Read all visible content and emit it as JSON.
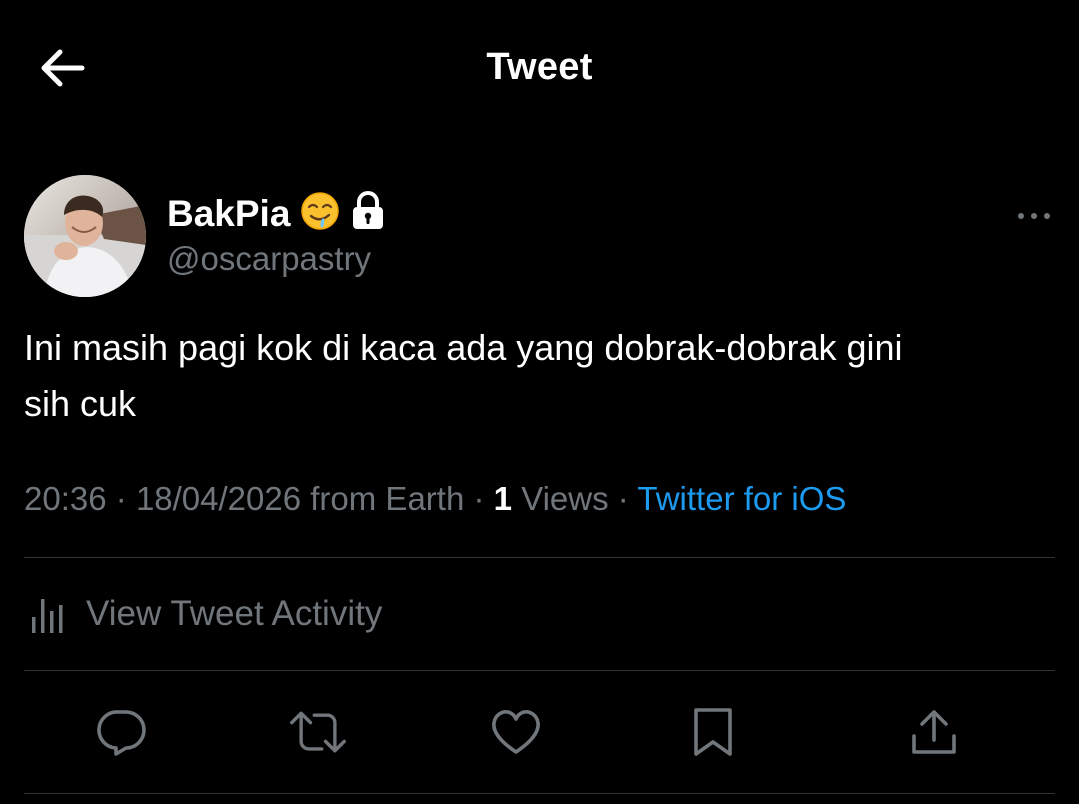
{
  "header": {
    "title": "Tweet",
    "back_icon": "arrow-left-icon"
  },
  "author": {
    "display_name": "BakPia",
    "emoji": "🤤",
    "protected_icon": "lock-icon",
    "handle": "@oscarpastry",
    "more_icon": "more-horizontal-icon"
  },
  "tweet": {
    "text_line1": "Ini masih pagi kok di kaca ada yang dobrak-dobrak gini",
    "text_line2": "sih cuk"
  },
  "meta": {
    "time": "20:36",
    "separator": "·",
    "date": "18/04/2026 from Earth",
    "views_count": "1",
    "views_label": "Views",
    "source": "Twitter for iOS"
  },
  "activity": {
    "icon": "analytics-icon",
    "label": "View Tweet Activity"
  },
  "actions": [
    {
      "name": "reply",
      "icon": "reply-icon"
    },
    {
      "name": "retweet",
      "icon": "retweet-icon"
    },
    {
      "name": "like",
      "icon": "heart-icon"
    },
    {
      "name": "bookmark",
      "icon": "bookmark-icon"
    },
    {
      "name": "share",
      "icon": "share-icon"
    }
  ],
  "colors": {
    "background": "#000000",
    "text_primary": "#ffffff",
    "text_secondary": "#71767b",
    "link": "#1d9bf0",
    "divider": "#2f3336"
  }
}
